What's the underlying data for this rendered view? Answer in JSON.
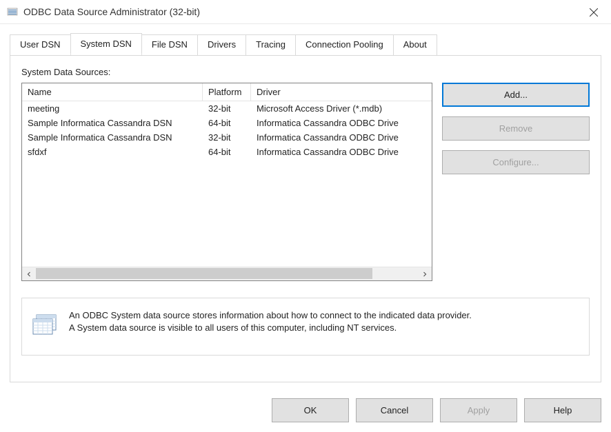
{
  "window": {
    "title": "ODBC Data Source Administrator (32-bit)"
  },
  "tabs": [
    {
      "label": "User DSN",
      "active": false
    },
    {
      "label": "System DSN",
      "active": true
    },
    {
      "label": "File DSN",
      "active": false
    },
    {
      "label": "Drivers",
      "active": false
    },
    {
      "label": "Tracing",
      "active": false
    },
    {
      "label": "Connection Pooling",
      "active": false
    },
    {
      "label": "About",
      "active": false
    }
  ],
  "list": {
    "label": "System Data Sources:",
    "columns": {
      "name": "Name",
      "platform": "Platform",
      "driver": "Driver"
    },
    "rows": [
      {
        "name": "meeting",
        "platform": "32-bit",
        "driver": "Microsoft Access Driver (*.mdb)"
      },
      {
        "name": "Sample Informatica Cassandra DSN",
        "platform": "64-bit",
        "driver": "Informatica Cassandra ODBC Drive"
      },
      {
        "name": "Sample Informatica Cassandra DSN",
        "platform": "32-bit",
        "driver": "Informatica Cassandra ODBC Drive"
      },
      {
        "name": "sfdxf",
        "platform": "64-bit",
        "driver": "Informatica Cassandra ODBC Drive"
      }
    ]
  },
  "side_buttons": {
    "add": "Add...",
    "remove": "Remove",
    "configure": "Configure..."
  },
  "info": {
    "line1": "An ODBC System data source stores information about how to connect to the indicated data provider.",
    "line2": "A System data source is visible to all users of this computer, including NT services."
  },
  "bottom_buttons": {
    "ok": "OK",
    "cancel": "Cancel",
    "apply": "Apply",
    "help": "Help"
  }
}
